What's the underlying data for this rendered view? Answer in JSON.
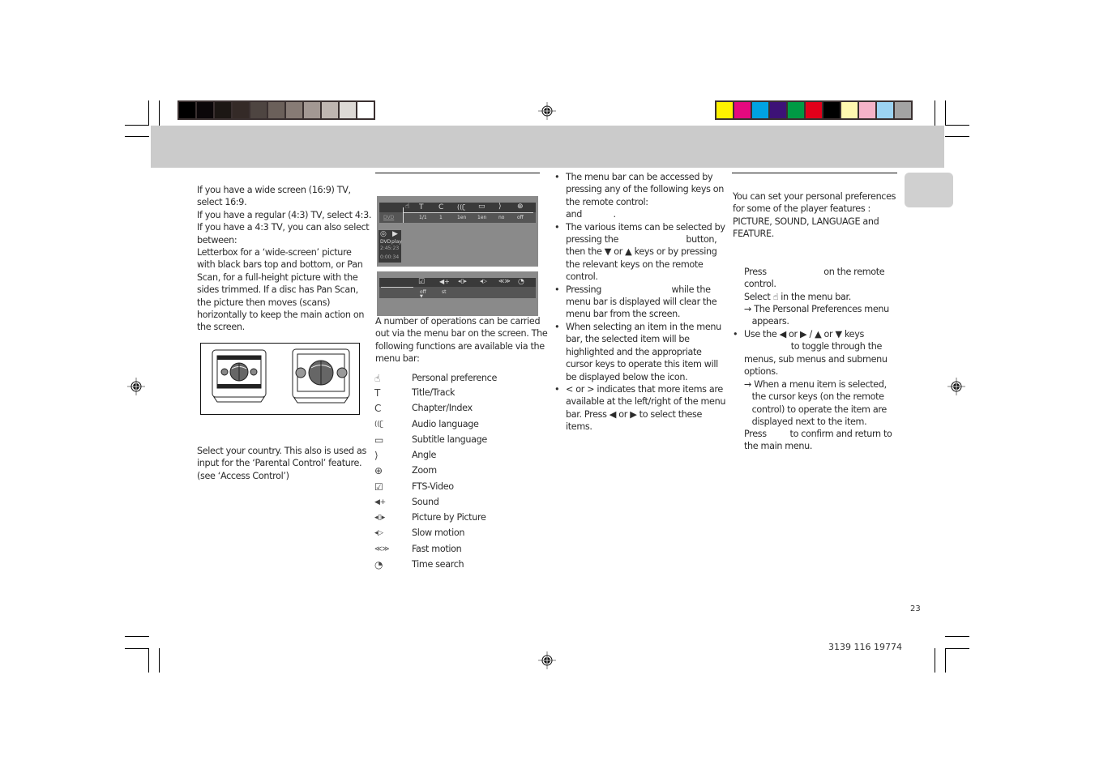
{
  "print_marks": {
    "grayscale_swatches": [
      "#000000",
      "#0b0709",
      "#1c1714",
      "#342a27",
      "#4e4541",
      "#6b605a",
      "#877b75",
      "#a39893",
      "#bfb6b1",
      "#ddd9d5",
      "#ffffff"
    ],
    "color_swatches": [
      "#fff200",
      "#e5097f",
      "#00a3e2",
      "#3d1277",
      "#009a44",
      "#e2001a",
      "#000000",
      "#fff9b0",
      "#f4b3c8",
      "#9cd3f2",
      "#a3a3a3"
    ]
  },
  "col1": {
    "aspect_text": [
      "If you have a wide screen (16:9) TV,",
      "select 16:9.",
      "If you have a regular (4:3) TV, select 4:3.",
      "If you have a 4:3 TV, you can also select",
      "between:",
      "Letterbox for a ‘wide-screen’ picture",
      "with black bars top and bottom, or Pan",
      "Scan, for a full-height picture with the",
      "sides trimmed. If a disc has Pan Scan,",
      "the picture then moves (scans)",
      "horizontally to keep the main action on",
      "the screen."
    ],
    "illustration_alt": [
      "letterbox-tv",
      "pan-scan-tv"
    ],
    "country_text": [
      "Select your country. This also is used as",
      "input for the ‘Parental Control’ feature.",
      "(see ‘Access Control’)"
    ]
  },
  "col2": {
    "osd1": {
      "disc_label": "DVD",
      "values": [
        "1/1",
        "1",
        "1en",
        "1en",
        "no",
        "off"
      ],
      "status_labels": [
        "DVD",
        "play"
      ],
      "time1": "2:45:23",
      "time2": "0:00:34"
    },
    "osd2": {
      "values": [
        "off",
        "st"
      ]
    },
    "intro": [
      "A number of operations can be carried",
      "out via the menu bar on the screen. The",
      "following functions are available via the",
      "menu bar:"
    ],
    "functions": [
      {
        "icon": "personal-preference-icon",
        "glyph": "☝",
        "label": "Personal preference"
      },
      {
        "icon": "title-track-icon",
        "glyph": "T",
        "label": "Title/Track"
      },
      {
        "icon": "chapter-index-icon",
        "glyph": "C",
        "label": "Chapter/Index"
      },
      {
        "icon": "audio-language-icon",
        "glyph": "((ʗ",
        "label": "Audio language"
      },
      {
        "icon": "subtitle-language-icon",
        "glyph": "▭",
        "label": "Subtitle language"
      },
      {
        "icon": "angle-icon",
        "glyph": "⟩",
        "label": "Angle"
      },
      {
        "icon": "zoom-icon",
        "glyph": "⊕",
        "label": "Zoom"
      },
      {
        "icon": "fts-video-icon",
        "glyph": "☑",
        "label": "FTS-Video"
      },
      {
        "icon": "sound-icon",
        "glyph": "◀+",
        "label": "Sound"
      },
      {
        "icon": "picture-by-picture-icon",
        "glyph": "◂▯▸",
        "label": "Picture by Picture"
      },
      {
        "icon": "slow-motion-icon",
        "glyph": "◂▷",
        "label": "Slow motion"
      },
      {
        "icon": "fast-motion-icon",
        "glyph": "≪≫",
        "label": "Fast motion"
      },
      {
        "icon": "time-search-icon",
        "glyph": "◔",
        "label": "Time search"
      }
    ]
  },
  "col3": {
    "bullets": [
      {
        "lines": [
          "The menu bar can be accessed by",
          "pressing any of the following keys on",
          "the remote control:",
          "and            ."
        ]
      },
      {
        "lines": [
          "The various items can be selected by",
          "pressing the                          button,",
          "then the ▼ or ▲ keys or by pressing",
          "the relevant keys on the remote",
          "control."
        ]
      },
      {
        "lines": [
          "Pressing                           while the",
          "menu bar is displayed will clear the",
          "menu bar from the screen."
        ]
      },
      {
        "lines": [
          "When selecting an item in the menu",
          "bar, the selected item will be",
          "highlighted and the appropriate",
          "cursor keys to operate this item will",
          "be displayed below the icon."
        ]
      },
      {
        "lines": [
          "< or > indicates that more items are",
          "available at the left/right of the menu",
          "bar. Press ◀ or ▶ to select these",
          "items."
        ]
      }
    ]
  },
  "col4": {
    "intro": [
      "You can set your personal preferences",
      "for some of the player features :",
      "PICTURE, SOUND, LANGUAGE and",
      "FEATURE."
    ],
    "steps": [
      "Press                      on the remote",
      "control.",
      "Select ☝ in the menu bar."
    ],
    "result1": [
      "→ The Personal Preferences menu",
      "   appears."
    ],
    "bullet": [
      "Use the ◀ or ▶ / ▲ or ▼ keys",
      "                  to toggle through the",
      "menus, sub menus and submenu",
      "options."
    ],
    "result2": [
      "→ When a menu item is selected,",
      "   the cursor keys (on the remote",
      "   control) to operate the item are",
      "   displayed next to the item."
    ],
    "confirm": [
      "Press         to confirm and return to",
      "the main menu."
    ]
  },
  "footer": {
    "page_number": "23",
    "doc_code": "3139 116 19774"
  }
}
